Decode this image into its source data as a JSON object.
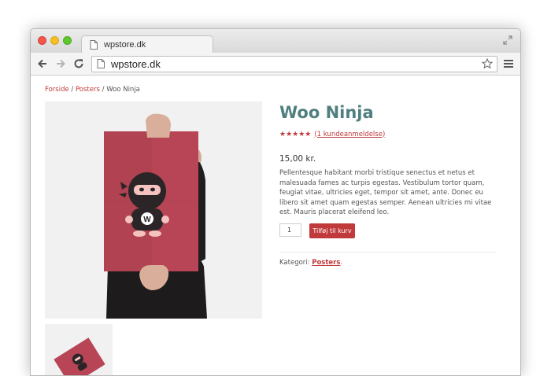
{
  "browser": {
    "tab_title": "wpstore.dk",
    "address_url": "wpstore.dk"
  },
  "breadcrumb": {
    "items": [
      "Forside",
      "Posters",
      "Woo Ninja"
    ],
    "separator": " / "
  },
  "product": {
    "title": "Woo Ninja",
    "rating": {
      "stars": 5,
      "symbol": "★★★★★",
      "review_link": "(1 kundeanmeldelse)"
    },
    "price": "15,00 kr.",
    "description": "Pellentesque habitant morbi tristique senectus et netus et malesuada fames ac turpis egestas. Vestibulum tortor quam, feugiat vitae, ultricies eget, tempor sit amet, ante. Donec eu libero sit amet quam egestas semper. Aenean ultricies mi vitae est. Mauris placerat eleifend leo.",
    "quantity": "1",
    "add_to_cart_label": "Tilføj til kurv",
    "category_label": "Kategori:",
    "category_value": "Posters",
    "category_end": "."
  },
  "poster": {
    "letter": "W"
  },
  "colors": {
    "accent": "#c0393b",
    "title": "#4f7f7e",
    "poster": "#b84555"
  }
}
